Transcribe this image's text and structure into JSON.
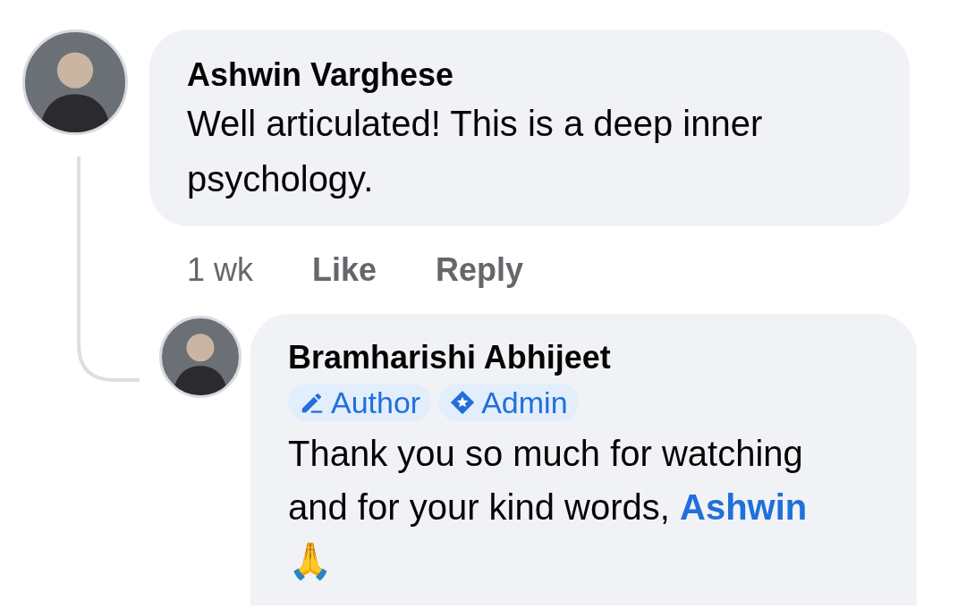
{
  "comment": {
    "author": "Ashwin Varghese",
    "text": "Well articulated! This is a deep inner psychology.",
    "time": "1 wk",
    "actions": [
      {
        "label": "Like"
      },
      {
        "label": "Reply"
      }
    ]
  },
  "reply": {
    "author": "Bramharishi Abhijeet",
    "badges": [
      {
        "kind": "author",
        "label": "Author"
      },
      {
        "kind": "admin",
        "label": "Admin"
      }
    ],
    "text": "Thank you so much for watching and for your kind words,",
    "mention": "Ashwin",
    "emoji": "🙏"
  }
}
